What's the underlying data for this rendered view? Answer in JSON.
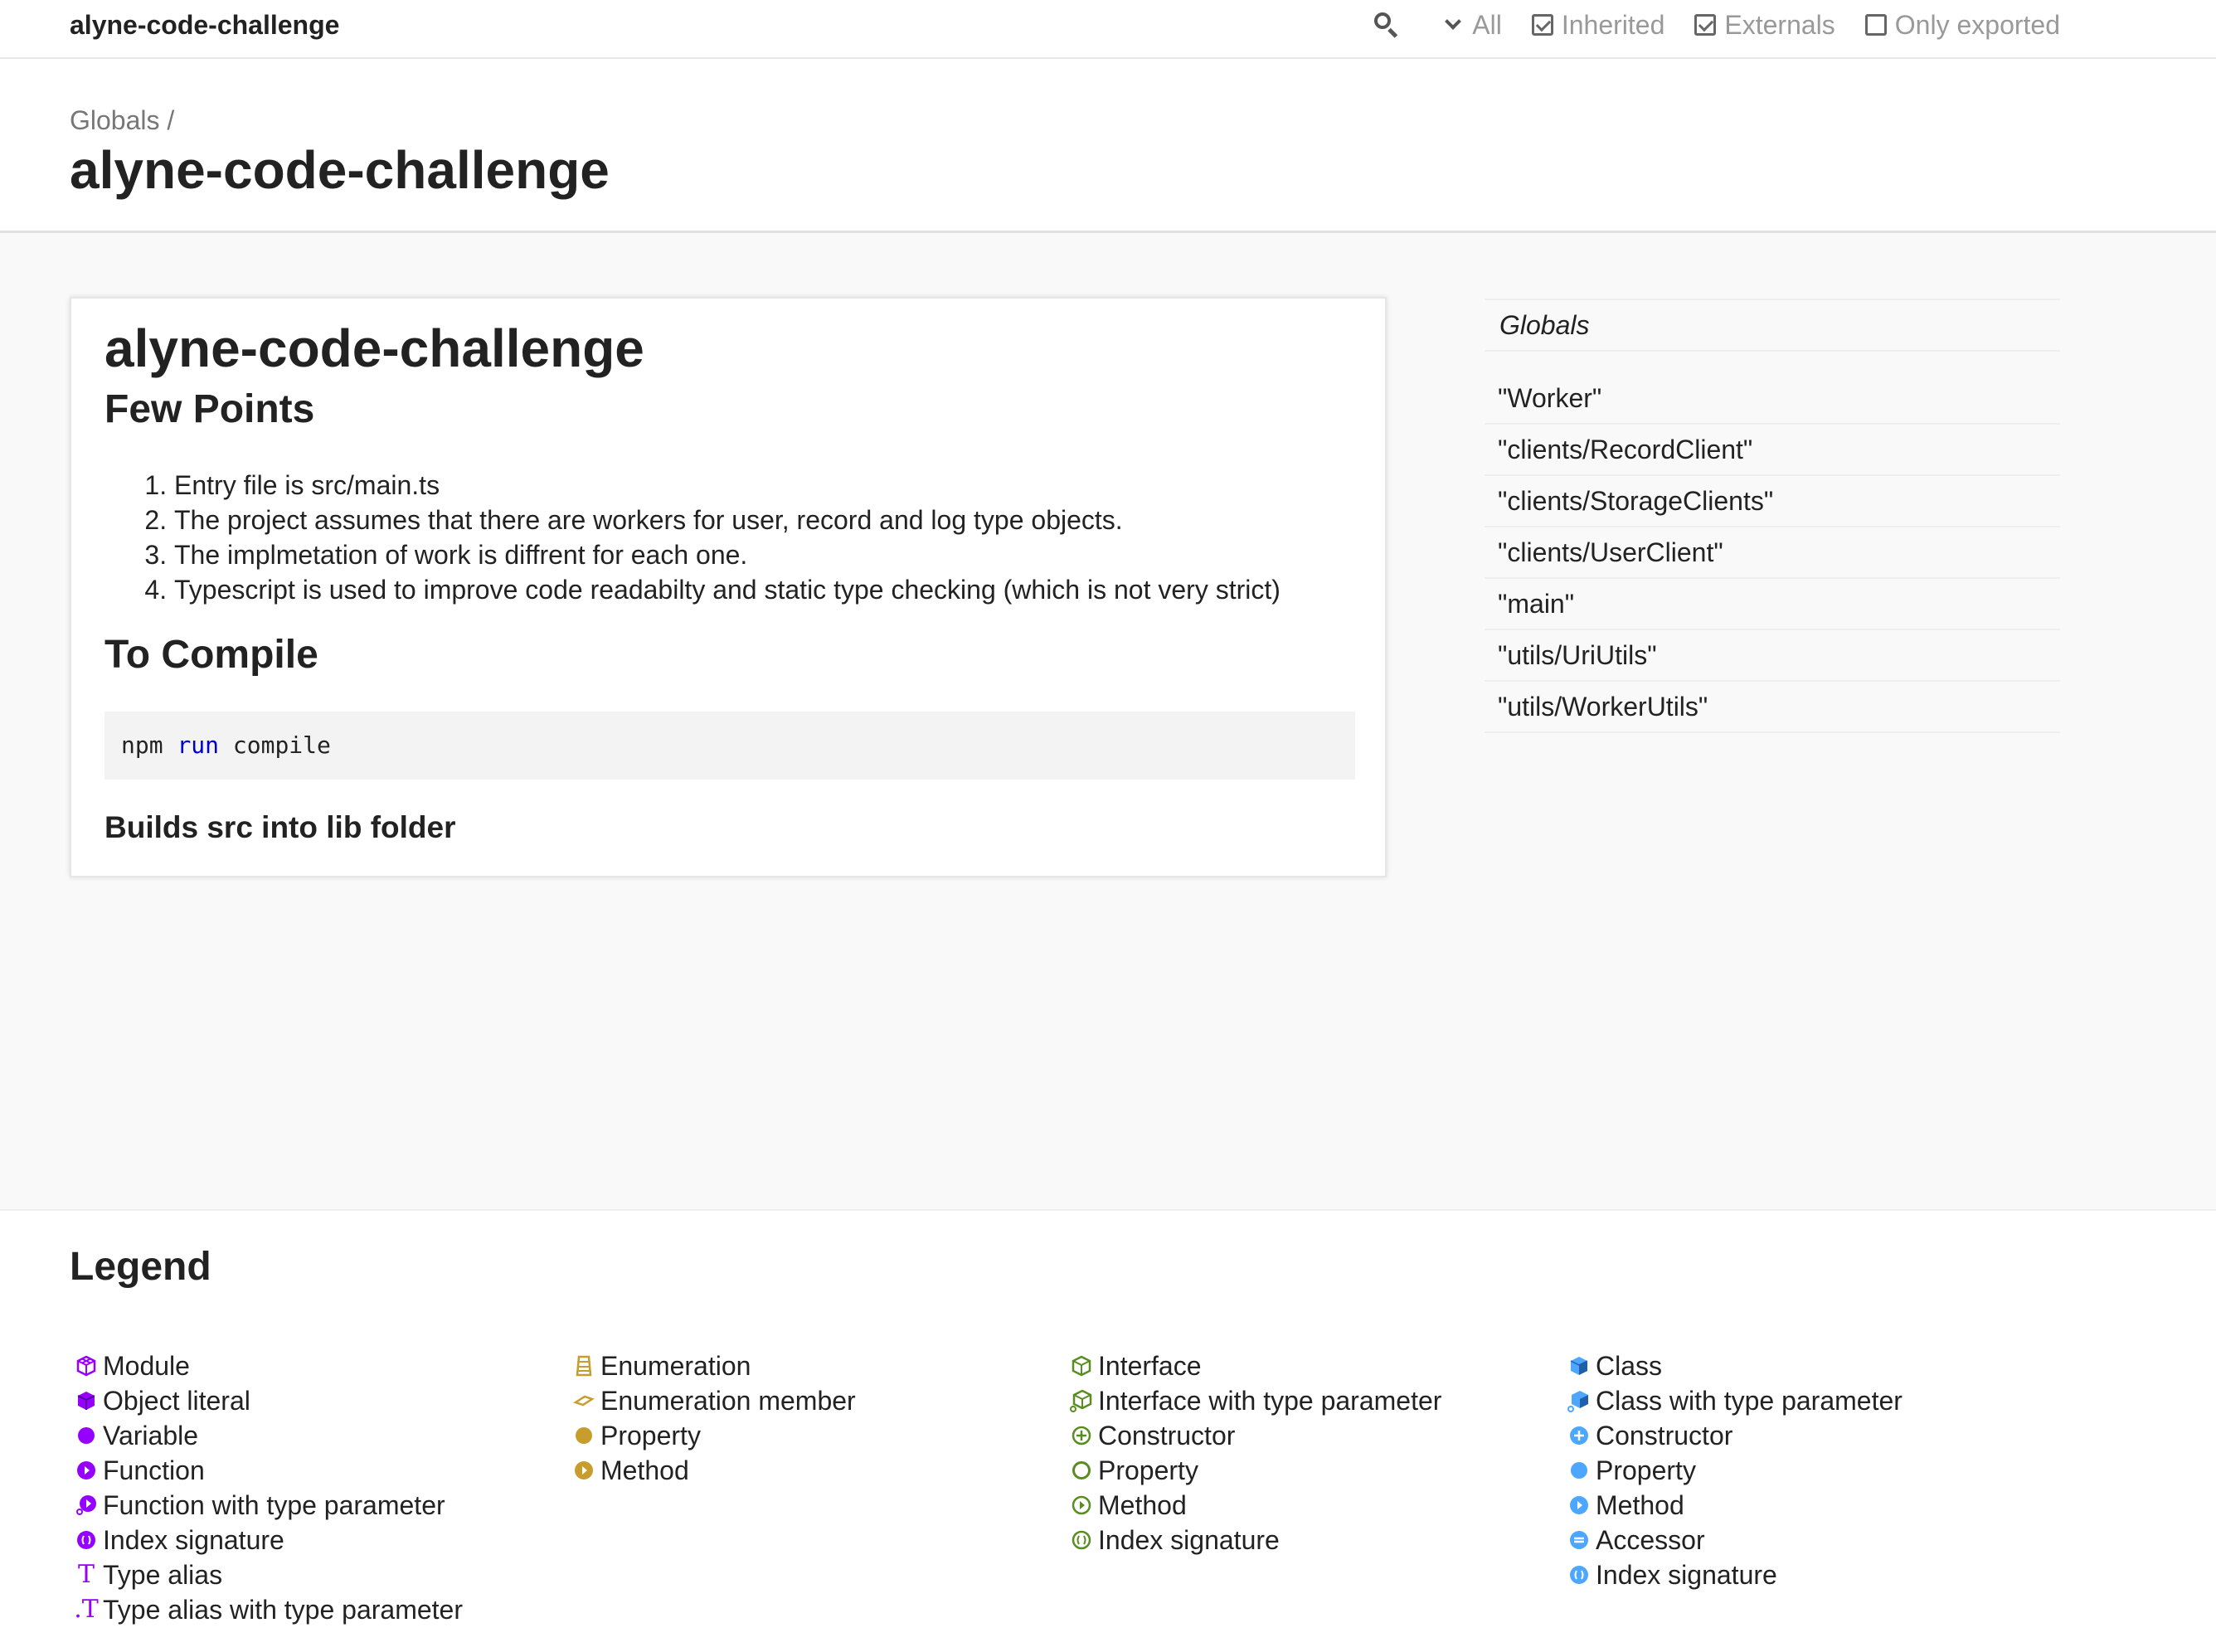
{
  "toolbar": {
    "title": "alyne-code-challenge",
    "filters": [
      {
        "label": "All",
        "kind": "dropdown"
      },
      {
        "label": "Inherited",
        "checked": true
      },
      {
        "label": "Externals",
        "checked": true
      },
      {
        "label": "Only exported",
        "checked": false
      }
    ]
  },
  "header": {
    "breadcrumb": "Globals /",
    "title": "alyne-code-challenge"
  },
  "readme": {
    "title": "alyne-code-challenge",
    "section1": "Few Points",
    "points": [
      "Entry file is src/main.ts",
      "The project assumes that there are workers for user, record and log type objects.",
      "The implmetation of work is diffrent for each one.",
      "Typescript is used to improve code readabilty and static type checking (which is not very strict)"
    ],
    "section2": "To Compile",
    "code": {
      "cmd": "npm",
      "keyword": "run",
      "arg": "compile"
    },
    "section3": "Builds src into lib folder"
  },
  "sidebar": {
    "heading": "Globals",
    "items": [
      "\"Worker\"",
      "\"clients/RecordClient\"",
      "\"clients/StorageClients\"",
      "\"clients/UserClient\"",
      "\"main\"",
      "\"utils/UriUtils\"",
      "\"utils/WorkerUtils\""
    ]
  },
  "legend": {
    "title": "Legend",
    "colors": {
      "purple": "#9600ff",
      "gold": "#c79d2d",
      "green": "#598d20",
      "blue": "#4da6ff"
    },
    "col1": [
      "Module",
      "Object literal",
      "Variable",
      "Function",
      "Function with type parameter",
      "Index signature",
      "Type alias",
      "Type alias with type parameter"
    ],
    "col2": [
      "Enumeration",
      "Enumeration member",
      "Property",
      "Method"
    ],
    "col3": [
      "Interface",
      "Interface with type parameter",
      "Constructor",
      "Property",
      "Method",
      "Index signature"
    ],
    "col4": [
      "Class",
      "Class with type parameter",
      "Constructor",
      "Property",
      "Method",
      "Accessor",
      "Index signature"
    ]
  }
}
